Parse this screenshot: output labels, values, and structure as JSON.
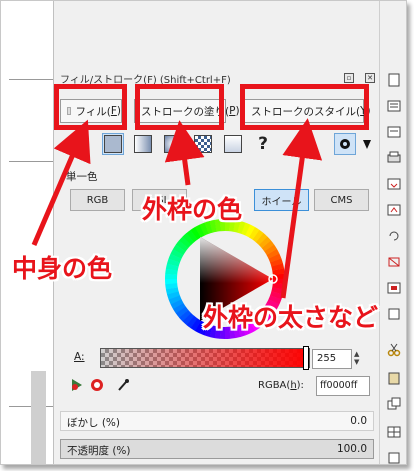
{
  "dialog": {
    "title": "フィル/ストローク(F) (Shift+Ctrl+F)",
    "tabs": [
      {
        "label": "フィル(",
        "key": "F",
        "tail": ")"
      },
      {
        "label": "ストロークの塗り(",
        "key": "P",
        "tail": ")"
      },
      {
        "label": "ストロークのスタイル(",
        "key": "Y",
        "tail": ")"
      }
    ],
    "paint_types": [
      "no-paint-icon",
      "flat-color-icon",
      "linear-gradient-icon",
      "radial-gradient-icon",
      "pattern-icon",
      "swatch-icon",
      "unset-paint-icon"
    ],
    "mode_label": "単一色",
    "color_modes": [
      "RGB",
      "HSL",
      "ホイール",
      "CMS"
    ],
    "selected_mode": "ホイール",
    "current_color": "#ff0000",
    "alpha_label": "A:",
    "alpha_value": "255",
    "rgba_label": "RGBA(",
    "rgba_key": "h",
    "rgba_tail": "):",
    "rgba_value": "ff0000ff",
    "blur_label": "ぼかし (%)",
    "blur_value": "0.0",
    "opacity_label": "不透明度 (%)",
    "opacity_value": "100.0"
  },
  "annotations": {
    "color": "#e8141b",
    "fill_color": "中身の色",
    "stroke_color": "外枠の色",
    "stroke_style": "外枠の太さなど"
  }
}
